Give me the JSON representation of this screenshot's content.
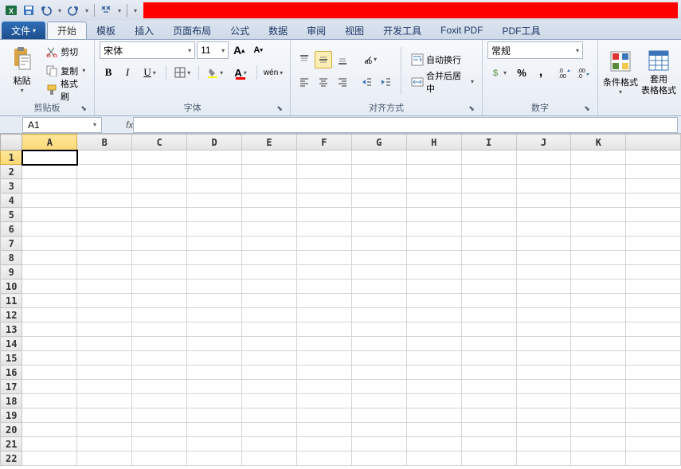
{
  "qat": {
    "app_icon": "excel",
    "items": [
      "save",
      "undo",
      "redo",
      "find"
    ]
  },
  "tabs": {
    "file": "文件",
    "items": [
      "开始",
      "模板",
      "插入",
      "页面布局",
      "公式",
      "数据",
      "审阅",
      "视图",
      "开发工具",
      "Foxit PDF",
      "PDF工具"
    ],
    "active_index": 0
  },
  "ribbon": {
    "clipboard": {
      "paste": "粘贴",
      "cut": "剪切",
      "copy": "复制",
      "format_painter": "格式刷",
      "label": "剪贴板"
    },
    "font": {
      "name": "宋体",
      "size": "11",
      "grow": "A",
      "shrink": "A",
      "bold": "B",
      "italic": "I",
      "underline": "U",
      "pinyin": "wén",
      "label": "字体"
    },
    "alignment": {
      "wrap": "自动换行",
      "merge": "合并后居中",
      "label": "对齐方式"
    },
    "number": {
      "format": "常规",
      "label": "数字"
    },
    "styles": {
      "conditional": "条件格式",
      "table": "套用\n表格格式"
    }
  },
  "namebox": {
    "value": "A1"
  },
  "formula": {
    "fx": "fx",
    "value": ""
  },
  "grid": {
    "columns": [
      "A",
      "B",
      "C",
      "D",
      "E",
      "F",
      "G",
      "H",
      "I",
      "J",
      "K"
    ],
    "rows": 22,
    "selected": {
      "row": 1,
      "col": "A"
    }
  }
}
